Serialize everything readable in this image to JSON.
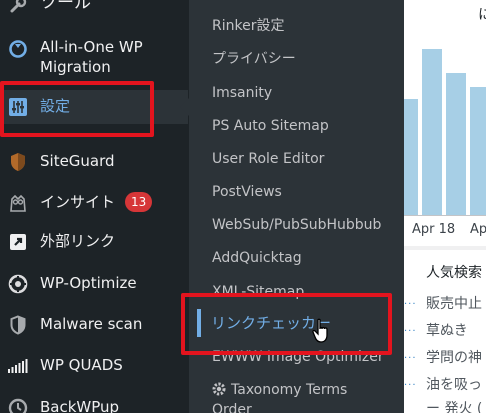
{
  "sidebar": {
    "items": [
      {
        "label": "ツール"
      },
      {
        "label": "All-in-One WP",
        "label2": "Migration"
      },
      {
        "label": "設定"
      },
      {
        "label": "SiteGuard"
      },
      {
        "label": "インサイト",
        "badge": "13"
      },
      {
        "label": "外部リンク"
      },
      {
        "label": "WP-Optimize"
      },
      {
        "label": "Malware scan"
      },
      {
        "label": "WP QUADS"
      },
      {
        "label": "BackWPup"
      }
    ]
  },
  "submenu": {
    "items": [
      {
        "label": "Rinker設定"
      },
      {
        "label": "プライバシー"
      },
      {
        "label": "Imsanity"
      },
      {
        "label": "PS Auto Sitemap"
      },
      {
        "label": "User Role Editor"
      },
      {
        "label": "PostViews"
      },
      {
        "label": "WebSub/PubSubHubbub"
      },
      {
        "label": "AddQuicktag"
      },
      {
        "label": "XML-Sitemap"
      },
      {
        "label": "リンクチェッカー"
      },
      {
        "label": "EWWW Image Optimizer"
      },
      {
        "label": "Taxonomy Terms",
        "label2": "Order"
      }
    ]
  },
  "content": {
    "header_fragment": "に",
    "chart": {
      "tick_labels": [
        "Apr 18",
        "Apr"
      ],
      "bar_levels": [
        0.58,
        0.83,
        0.71,
        0.64
      ]
    },
    "popular_title": "人気検索",
    "popular_rows": [
      "販売中止",
      "草ぬき",
      "学問の神",
      "油を吸っ",
      "ー 発火 ("
    ]
  },
  "colors": {
    "menu_bg": "#1d2327",
    "submenu_bg": "#2c3338",
    "accent": "#72aee6",
    "highlight": "#e3141e",
    "badge": "#d63638",
    "bar": "#a7cfe6"
  }
}
